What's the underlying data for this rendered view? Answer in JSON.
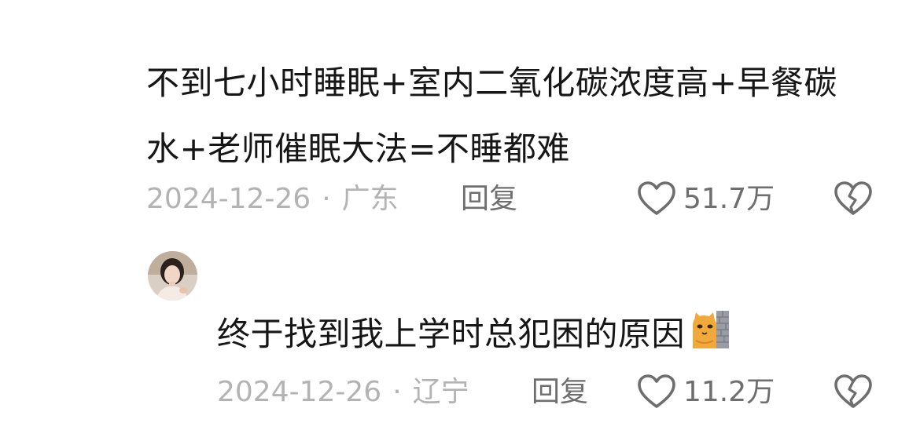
{
  "comments": [
    {
      "text": "不到七小时睡眠+室内二氧化碳浓度高+早餐碳水+老师催眠大法=不睡都难",
      "date": "2024-12-26",
      "separator": "·",
      "location": "广东",
      "reply_label": "回复",
      "likes": "51.7万",
      "like_icon": "heart-outline-icon",
      "dislike_icon": "broken-heart-icon"
    },
    {
      "text": "终于找到我上学时总犯困的原因",
      "emoji": "cat-peeking-wall-emoji",
      "date": "2024-12-26",
      "separator": "·",
      "location": "辽宁",
      "reply_label": "回复",
      "likes": "11.2万",
      "like_icon": "heart-outline-icon",
      "dislike_icon": "broken-heart-icon"
    }
  ],
  "colors": {
    "text": "#161616",
    "meta": "#b3b3b3",
    "action": "#6e6e6e",
    "background": "#ffffff"
  }
}
